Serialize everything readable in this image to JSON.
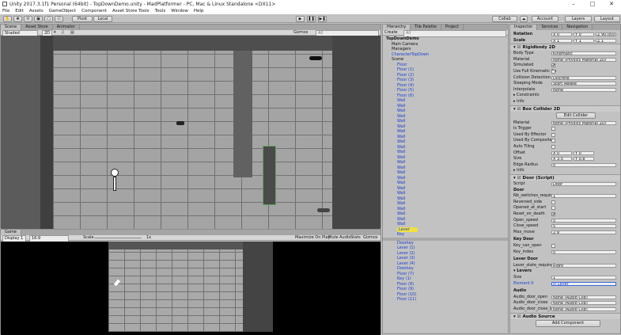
{
  "window": {
    "title": "Unity 2017.3.1f1 Personal (64bit) - TopDownDemo.unity - MadPlatformer - PC, Mac & Linux Standalone <DX11>"
  },
  "menu": [
    "File",
    "Edit",
    "Assets",
    "GameObject",
    "Component",
    "Asset Store Tools",
    "Tools",
    "Window",
    "Help"
  ],
  "toolbar": {
    "pivot": "Pivot",
    "local": "Local",
    "collab": "Collab",
    "account": "Account",
    "layers": "Layers",
    "layout": "Layout"
  },
  "scene": {
    "tabs": [
      "Scene",
      "Asset Store",
      "Animator"
    ],
    "shading": "Shaded",
    "mode": "2D",
    "gizmos": "Gizmos",
    "search": "All"
  },
  "game": {
    "tab": "Game",
    "display": "Display 1",
    "aspect": "16:9",
    "scale_label": "Scale",
    "scale_value": "1x",
    "opts": [
      "Maximize On Play",
      "Mute Audio",
      "Stats",
      "Gizmos"
    ]
  },
  "hierarchy": {
    "tab": "Hierarchy",
    "create": "Create",
    "search": "All",
    "other_tabs": [
      "Tile Palette",
      "Project"
    ],
    "items": [
      {
        "t": "TopDownDemo",
        "i": 0,
        "c": "k",
        "b": true
      },
      {
        "t": "Main Camera",
        "i": 1,
        "c": "k"
      },
      {
        "t": "Managers",
        "i": 1,
        "c": "k"
      },
      {
        "t": "CharacterTopDown",
        "i": 1,
        "c": "b"
      },
      {
        "t": "Scene",
        "i": 1,
        "c": "k"
      },
      {
        "t": "Floor",
        "i": 2,
        "c": "b"
      },
      {
        "t": "Floor (1)",
        "i": 2,
        "c": "b"
      },
      {
        "t": "Floor (2)",
        "i": 2,
        "c": "b"
      },
      {
        "t": "Floor (3)",
        "i": 2,
        "c": "b"
      },
      {
        "t": "Floor (4)",
        "i": 2,
        "c": "b"
      },
      {
        "t": "Floor (5)",
        "i": 2,
        "c": "b"
      },
      {
        "t": "Floor (6)",
        "i": 2,
        "c": "b"
      },
      {
        "t": "Wall",
        "i": 2,
        "c": "b"
      },
      {
        "t": "Wall",
        "i": 2,
        "c": "b"
      },
      {
        "t": "Wall",
        "i": 2,
        "c": "b"
      },
      {
        "t": "Wall",
        "i": 2,
        "c": "b"
      },
      {
        "t": "Wall",
        "i": 2,
        "c": "b"
      },
      {
        "t": "Wall",
        "i": 2,
        "c": "b"
      },
      {
        "t": "Wall",
        "i": 2,
        "c": "b"
      },
      {
        "t": "Wall",
        "i": 2,
        "c": "b"
      },
      {
        "t": "Wall",
        "i": 2,
        "c": "b"
      },
      {
        "t": "Wall",
        "i": 2,
        "c": "b"
      },
      {
        "t": "Wall",
        "i": 2,
        "c": "b"
      },
      {
        "t": "Wall",
        "i": 2,
        "c": "b"
      },
      {
        "t": "Wall",
        "i": 2,
        "c": "b"
      },
      {
        "t": "Wall",
        "i": 2,
        "c": "b"
      },
      {
        "t": "Wall",
        "i": 2,
        "c": "b"
      },
      {
        "t": "Wall",
        "i": 2,
        "c": "b"
      },
      {
        "t": "Wall",
        "i": 2,
        "c": "b"
      },
      {
        "t": "Wall",
        "i": 2,
        "c": "b"
      },
      {
        "t": "Wall",
        "i": 2,
        "c": "b"
      },
      {
        "t": "Wall",
        "i": 2,
        "c": "b"
      },
      {
        "t": "Wall",
        "i": 2,
        "c": "b"
      },
      {
        "t": "Wall",
        "i": 2,
        "c": "b"
      },
      {
        "t": "Wall",
        "i": 2,
        "c": "b"
      },
      {
        "t": "Wall",
        "i": 2,
        "c": "b"
      },
      {
        "t": "Wall",
        "i": 2,
        "c": "b"
      },
      {
        "t": "Lever",
        "i": 2,
        "c": "b",
        "sel": true
      },
      {
        "t": "Key",
        "i": 2,
        "c": "b"
      },
      {
        "t": "",
        "i": 2,
        "c": "k",
        "sep": true
      },
      {
        "t": "Doorkey",
        "i": 2,
        "c": "b"
      },
      {
        "t": "Lever (1)",
        "i": 2,
        "c": "b"
      },
      {
        "t": "Lever (2)",
        "i": 2,
        "c": "b"
      },
      {
        "t": "Lever (3)",
        "i": 2,
        "c": "b"
      },
      {
        "t": "Lever (4)",
        "i": 2,
        "c": "b"
      },
      {
        "t": "Doorkey",
        "i": 2,
        "c": "b"
      },
      {
        "t": "Floor (7)",
        "i": 2,
        "c": "b"
      },
      {
        "t": "Key (1)",
        "i": 2,
        "c": "b"
      },
      {
        "t": "Floor (8)",
        "i": 2,
        "c": "b"
      },
      {
        "t": "Floor (9)",
        "i": 2,
        "c": "b"
      },
      {
        "t": "Floor (10)",
        "i": 2,
        "c": "b"
      },
      {
        "t": "Floor (11)",
        "i": 2,
        "c": "b"
      }
    ]
  },
  "inspector": {
    "tabs": [
      "Inspector",
      "Services",
      "Navigation"
    ],
    "rotation": {
      "label": "Rotation",
      "x": "0",
      "y": "0",
      "z": "90.000"
    },
    "scale": {
      "label": "Scale",
      "x": "1",
      "y": "1",
      "z": "1"
    },
    "rigidbody": {
      "title": "Rigidbody 2D",
      "rows": [
        [
          "Body Type",
          "Kinematic"
        ],
        [
          "Material",
          "None (Physics Material 2D)"
        ],
        [
          "Simulated",
          "✔"
        ],
        [
          "Use Full Kinematic Co",
          ""
        ],
        [
          "Collision Detection",
          "Discrete"
        ],
        [
          "Sleeping Mode",
          "Start Awake"
        ],
        [
          "Interpolate",
          "None"
        ]
      ],
      "folds": [
        "Constraints",
        "Info"
      ]
    },
    "boxcollider": {
      "title": "Box Collider 2D",
      "edit": "Edit Collider",
      "rows": [
        [
          "Material",
          "None (Physics Material 2D)"
        ],
        [
          "Is Trigger",
          ""
        ],
        [
          "Used By Effector",
          ""
        ],
        [
          "Used By Composite",
          ""
        ],
        [
          "Auto Tiling",
          ""
        ]
      ],
      "offset": {
        "label": "Offset",
        "x": "0",
        "y": "0"
      },
      "size": {
        "label": "Size",
        "x": "3.5",
        "y": "0.8"
      },
      "edge": {
        "label": "Edge Radius",
        "v": "0"
      },
      "info": "Info"
    },
    "door": {
      "title": "Door (Script)",
      "script": {
        "label": "Script",
        "v": "Door"
      },
      "section": "Door",
      "rows": [
        [
          "Nb_switches_require",
          "1"
        ],
        [
          "Reversed_side",
          ""
        ],
        [
          "Opened_at_start",
          ""
        ],
        [
          "Reset_on_death",
          "✔"
        ],
        [
          "Open_speed",
          "5"
        ],
        [
          "Close_speed",
          "5"
        ],
        [
          "Max_move",
          "2.9"
        ]
      ],
      "keysec": "Key Door",
      "keyrows": [
        [
          "Key_can_open",
          ""
        ],
        [
          "Key_index",
          "0"
        ]
      ],
      "leversec": "Lever Door",
      "leverstate": [
        "Lever_state_required",
        "Right"
      ],
      "levers": {
        "label": "Levers",
        "size_label": "Size",
        "size": "1",
        "el_label": "Element 0",
        "el": "Lever"
      },
      "audiosec": "Audio",
      "audiorows": [
        [
          "Audio_door_open",
          "None (Audio Clip)"
        ],
        [
          "Audio_door_close",
          "None (Audio Clip)"
        ],
        [
          "Audio_door_close_b",
          "None (Audio Clip)"
        ]
      ]
    },
    "audiosource": "Audio Source",
    "add": "Add Component"
  },
  "colors": {
    "bg": "#c2c2c2",
    "selected": "#f0e040",
    "link": "#1b3fd1"
  }
}
